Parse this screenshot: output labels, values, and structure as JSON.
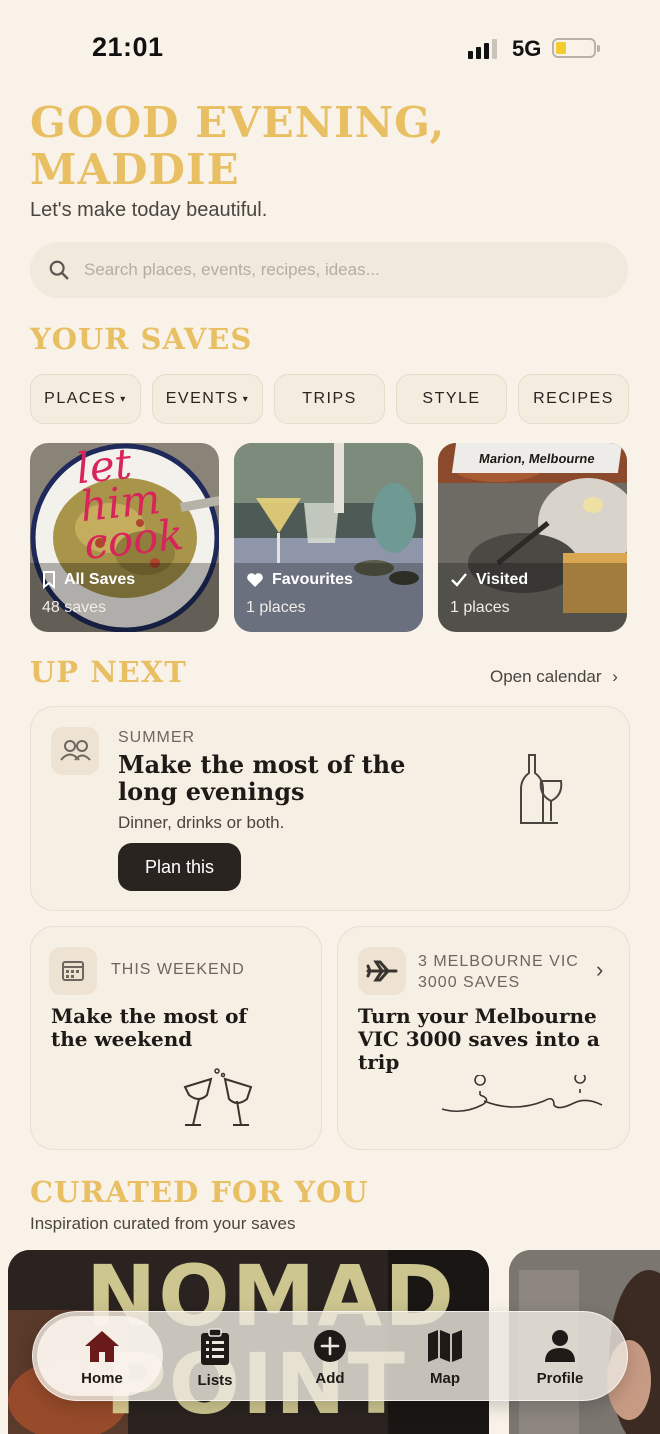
{
  "status_bar": {
    "time": "21:01",
    "network": "5G"
  },
  "greeting": {
    "line1": "GOOD EVENING,",
    "line2": "MADDIE",
    "subtitle": "Let's make today beautiful."
  },
  "search": {
    "placeholder": "Search places, events, recipes, ideas..."
  },
  "saves": {
    "title": "YOUR SAVES",
    "chips": [
      "PLACES",
      "EVENTS",
      "TRIPS",
      "STYLE",
      "RECIPES"
    ],
    "cards": [
      {
        "label": "All Saves",
        "count": "48 saves",
        "overlay_text": "let him cook"
      },
      {
        "label": "Favourites",
        "count": "1 places"
      },
      {
        "label": "Visited",
        "count": "1 places",
        "tag": "Marion, Melbourne"
      }
    ]
  },
  "up_next": {
    "title": "UP NEXT",
    "calendar_link": "Open calendar",
    "summer": {
      "kicker": "SUMMER",
      "title_l1": "Make the most of the",
      "title_l2": "long evenings",
      "subtitle": "Dinner, drinks or both.",
      "button": "Plan this"
    },
    "weekend": {
      "kicker": "THIS WEEKEND",
      "title_l1": "Make the most of",
      "title_l2": "the weekend"
    },
    "trip": {
      "kicker_l1": "3 MELBOURNE VIC",
      "kicker_l2": "3000 SAVES",
      "title_l1": "Turn your Melbourne",
      "title_l2": "VIC 3000 saves into a",
      "title_l3": "trip"
    }
  },
  "curated": {
    "title": "CURATED FOR YOU",
    "subtitle": "Inspiration curated from your saves",
    "image_text": "NOMAD POINT"
  },
  "tab_bar": {
    "active": "Home",
    "tabs": [
      {
        "label": "Home",
        "icon": "home-icon"
      },
      {
        "label": "Lists",
        "icon": "clipboard-list-icon"
      },
      {
        "label": "Add",
        "icon": "plus-circle-icon"
      },
      {
        "label": "Map",
        "icon": "map-icon"
      },
      {
        "label": "Profile",
        "icon": "user-icon"
      }
    ]
  },
  "colors": {
    "accent": "#e9bf64",
    "background": "#f8f2e8",
    "dark": "#2a2420",
    "home_active": "#6b1a1a"
  }
}
